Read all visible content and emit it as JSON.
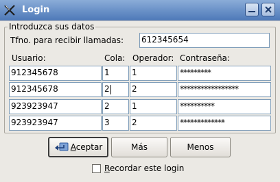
{
  "window": {
    "title": "Login",
    "icons": {
      "app": "x-app-icon",
      "minimize": "minimize-icon",
      "close": "close-icon"
    }
  },
  "group": {
    "legend": "Introduzca sus datos"
  },
  "phone": {
    "label": "Tfno. para recibir llamadas:",
    "value": "612345654"
  },
  "columns": {
    "user": "Usuario:",
    "cola": "Cola:",
    "operator": "Operador:",
    "password": "Contraseña:"
  },
  "rows": [
    {
      "user": "912345678",
      "cola": "1",
      "operator": "1",
      "password": "*********"
    },
    {
      "user": "912345678",
      "cola": "2",
      "operator": "2",
      "password": "*****************"
    },
    {
      "user": "923923947",
      "cola": "2",
      "operator": "1",
      "password": "**********"
    },
    {
      "user": "923923947",
      "cola": "3",
      "operator": "2",
      "password": "*************"
    }
  ],
  "buttons": {
    "accept_mnemonic": "A",
    "accept_rest": "ceptar",
    "accept_icon": "enter-arrow-icon",
    "more": "Más",
    "less": "Menos"
  },
  "remember": {
    "mnemonic": "R",
    "rest": "ecordar este login",
    "checked": false
  }
}
